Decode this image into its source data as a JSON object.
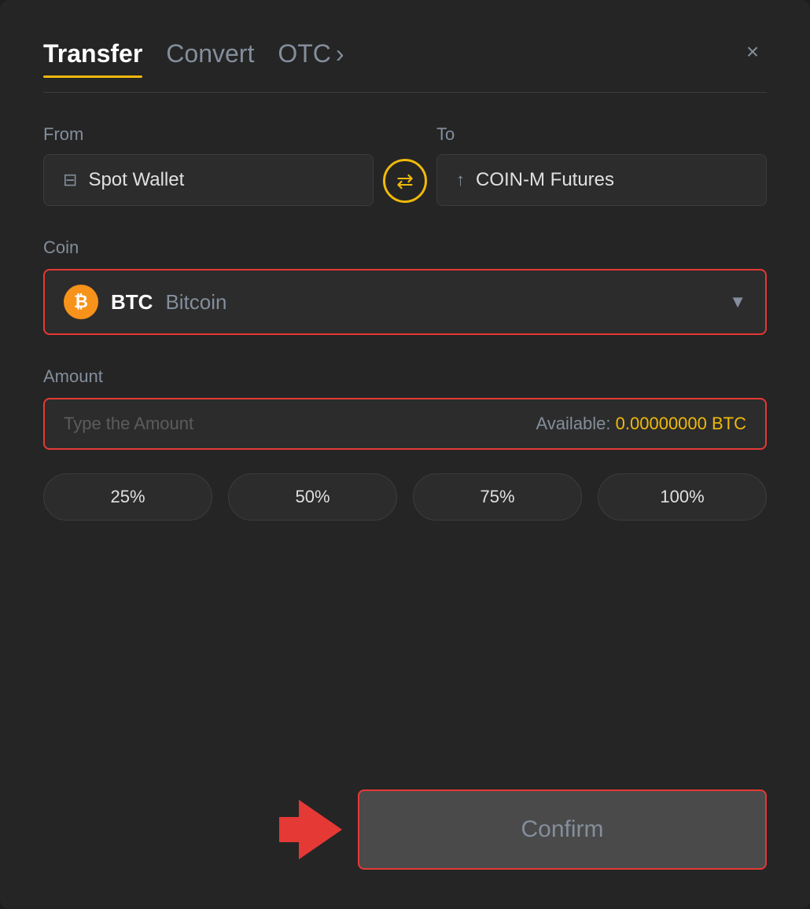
{
  "header": {
    "active_tab": "Transfer",
    "tab_convert": "Convert",
    "tab_otc": "OTC",
    "close_label": "×"
  },
  "from": {
    "label": "From",
    "wallet_name": "Spot Wallet"
  },
  "to": {
    "label": "To",
    "wallet_name": "COIN-M Futures"
  },
  "coin": {
    "label": "Coin",
    "symbol": "BTC",
    "full_name": "Bitcoin"
  },
  "amount": {
    "label": "Amount",
    "placeholder": "Type the Amount",
    "available_label": "Available:",
    "available_value": "0.00000000 BTC"
  },
  "percentage_buttons": [
    {
      "label": "25%"
    },
    {
      "label": "50%"
    },
    {
      "label": "75%"
    },
    {
      "label": "100%"
    }
  ],
  "confirm_button": {
    "label": "Confirm"
  }
}
